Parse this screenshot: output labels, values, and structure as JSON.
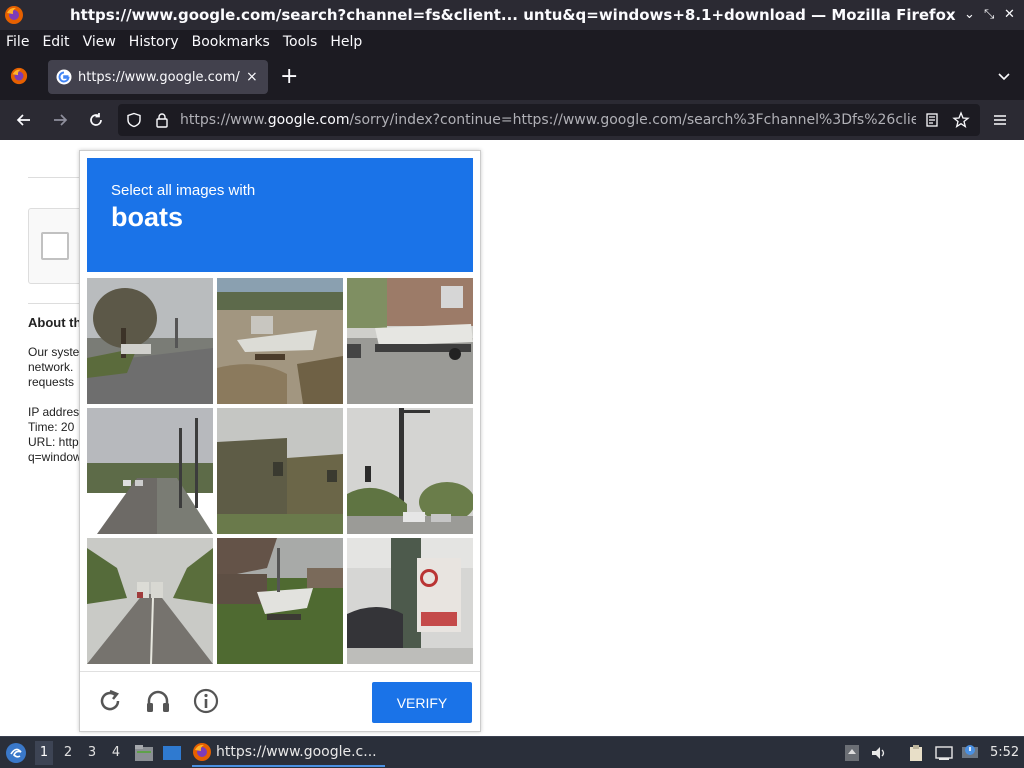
{
  "window": {
    "title": "https://www.google.com/search?channel=fs&client...  untu&q=windows+8.1+download — Mozilla Firefox"
  },
  "menubar": {
    "items": [
      {
        "label": "File"
      },
      {
        "label": "Edit"
      },
      {
        "label": "View"
      },
      {
        "label": "History"
      },
      {
        "label": "Bookmarks"
      },
      {
        "label": "Tools"
      },
      {
        "label": "Help"
      }
    ]
  },
  "tab": {
    "label": "https://www.google.com/",
    "close": "×"
  },
  "newtab": "+",
  "urlbar": {
    "prefix": "https://www.",
    "domain": "google.com",
    "suffix": "/sorry/index?continue=https://www.google.com/search%3Fchannel%3Dfs%26clie"
  },
  "page": {
    "about_heading": "About th",
    "para_line1": "Our syste",
    "para_line2": "network.",
    "para_line3": "requests",
    "ip_label": "IP addres",
    "time_label": "Time: 20",
    "url_label": "URL: http",
    "query_label": "q=window"
  },
  "captcha": {
    "instruction": "Select all images with",
    "target": "boats",
    "verify_label": "VERIFY",
    "tiles": [
      {
        "desc": "tree-road"
      },
      {
        "desc": "boat-yard"
      },
      {
        "desc": "boat-trailer-house"
      },
      {
        "desc": "road-poles"
      },
      {
        "desc": "buildings"
      },
      {
        "desc": "traffic-light"
      },
      {
        "desc": "highway-trees"
      },
      {
        "desc": "boat-grass"
      },
      {
        "desc": "sign-pole-car"
      }
    ],
    "colors": {
      "header_bg": "#1a73e8",
      "verify_bg": "#1a73e8"
    }
  },
  "taskbar": {
    "workspaces": [
      "1",
      "2",
      "3",
      "4"
    ],
    "task_label": "https://www.google.c...",
    "clock": "5:52"
  }
}
